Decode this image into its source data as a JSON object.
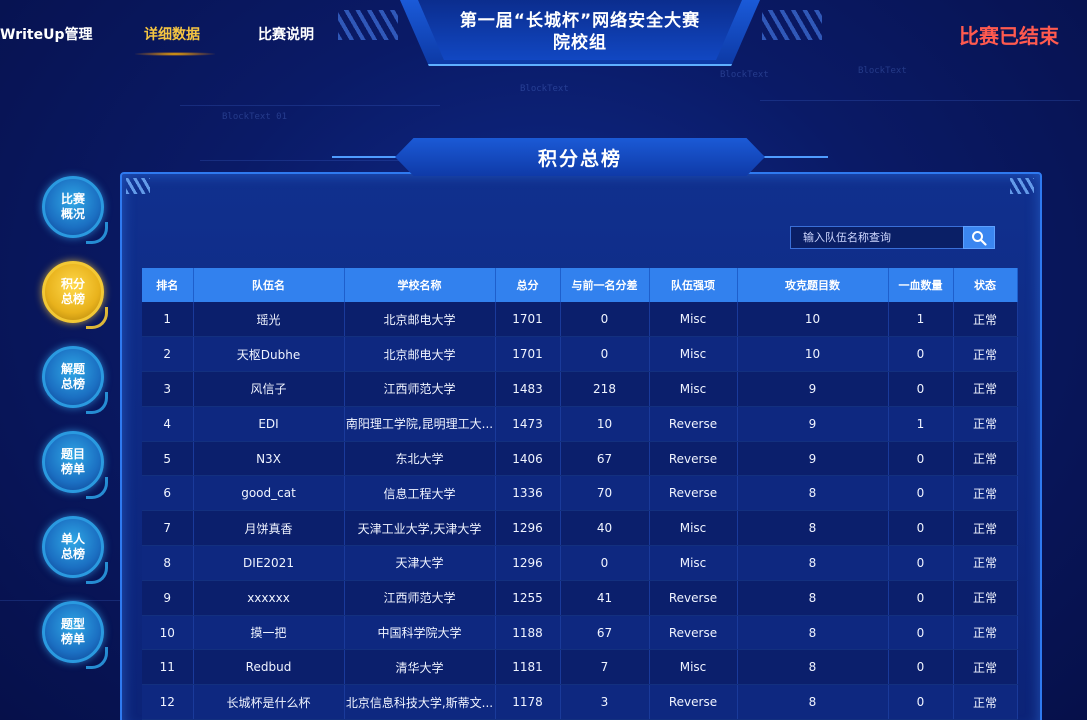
{
  "nav": {
    "items": [
      {
        "label": "WriteUp管理",
        "active": false
      },
      {
        "label": "详细数据",
        "active": true
      },
      {
        "label": "比赛说明",
        "active": false
      }
    ],
    "title_line1": "第一届“长城杯”网络安全大赛",
    "title_line2": "院校组",
    "status": "比赛已结束",
    "status_color": "#ff5a4f",
    "active_color": "#f5c542"
  },
  "sidebar": {
    "items": [
      {
        "label": "比赛概况",
        "active": false
      },
      {
        "label": "积分总榜",
        "active": true
      },
      {
        "label": "解题总榜",
        "active": false
      },
      {
        "label": "题目榜单",
        "active": false
      },
      {
        "label": "单人总榜",
        "active": false
      },
      {
        "label": "题型榜单",
        "active": false
      }
    ]
  },
  "panel": {
    "title": "积分总榜",
    "search_placeholder": "输入队伍名称查询",
    "search_icon": "search-icon"
  },
  "table": {
    "headers": [
      "排名",
      "队伍名",
      "学校名称",
      "总分",
      "与前一名分差",
      "队伍强项",
      "攻克题目数",
      "一血数量",
      "状态"
    ],
    "rows": [
      [
        "1",
        "瑶光",
        "北京邮电大学",
        "1701",
        "0",
        "Misc",
        "10",
        "1",
        "正常"
      ],
      [
        "2",
        "天枢Dubhe",
        "北京邮电大学",
        "1701",
        "0",
        "Misc",
        "10",
        "0",
        "正常"
      ],
      [
        "3",
        "风信子",
        "江西师范大学",
        "1483",
        "218",
        "Misc",
        "9",
        "0",
        "正常"
      ],
      [
        "4",
        "EDI",
        "南阳理工学院,昆明理工大...",
        "1473",
        "10",
        "Reverse",
        "9",
        "1",
        "正常"
      ],
      [
        "5",
        "N3X",
        "东北大学",
        "1406",
        "67",
        "Reverse",
        "9",
        "0",
        "正常"
      ],
      [
        "6",
        "good_cat",
        "信息工程大学",
        "1336",
        "70",
        "Reverse",
        "8",
        "0",
        "正常"
      ],
      [
        "7",
        "月饼真香",
        "天津工业大学,天津大学",
        "1296",
        "40",
        "Misc",
        "8",
        "0",
        "正常"
      ],
      [
        "8",
        "DIE2021",
        "天津大学",
        "1296",
        "0",
        "Misc",
        "8",
        "0",
        "正常"
      ],
      [
        "9",
        "xxxxxx",
        "江西师范大学",
        "1255",
        "41",
        "Reverse",
        "8",
        "0",
        "正常"
      ],
      [
        "10",
        "摸一把",
        "中国科学院大学",
        "1188",
        "67",
        "Reverse",
        "8",
        "0",
        "正常"
      ],
      [
        "11",
        "Redbud",
        "清华大学",
        "1181",
        "7",
        "Misc",
        "8",
        "0",
        "正常"
      ],
      [
        "12",
        "长城杯是什么杯",
        "北京信息科技大学,斯蒂文...",
        "1178",
        "3",
        "Reverse",
        "8",
        "0",
        "正常"
      ]
    ]
  },
  "background_text": [
    "BlockText 01",
    "BlockText",
    "BlockText",
    "BlockText"
  ]
}
